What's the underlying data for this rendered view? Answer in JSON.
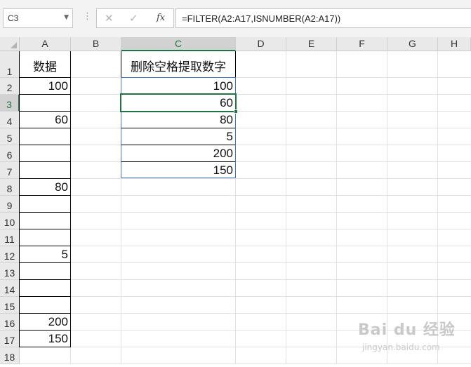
{
  "formula_bar": {
    "name_box": "C3",
    "name_box_arrow": "▼",
    "dots": "⋮",
    "cancel_glyph": "✕",
    "enter_glyph": "✓",
    "fx_label": "fx",
    "formula": "=FILTER(A2:A17,ISNUMBER(A2:A17))"
  },
  "sheet": {
    "columns": [
      "A",
      "B",
      "C",
      "D",
      "E",
      "F",
      "G",
      "H"
    ],
    "selected_column": "C",
    "rows": [
      "1",
      "2",
      "3",
      "4",
      "5",
      "6",
      "7",
      "8",
      "9",
      "10",
      "11",
      "12",
      "13",
      "14",
      "15",
      "16",
      "17",
      "18"
    ],
    "selected_row": "3",
    "active_cell": "C3"
  },
  "cells": {
    "A1": "数据",
    "A2": "100",
    "A4": "60",
    "A8": "80",
    "A12": "5",
    "A16": "200",
    "A17": "150",
    "C1": "删除空格提取数字",
    "C2": "100",
    "C3": "60",
    "C4": "80",
    "C5": "5",
    "C6": "200",
    "C7": "150"
  },
  "watermark": {
    "main": "Bai du 经验",
    "sub": "jingyan.baidu.com"
  },
  "colors": {
    "selection": "#217346",
    "spill_border": "#4472c4",
    "header_bg": "#e9e9e9"
  }
}
